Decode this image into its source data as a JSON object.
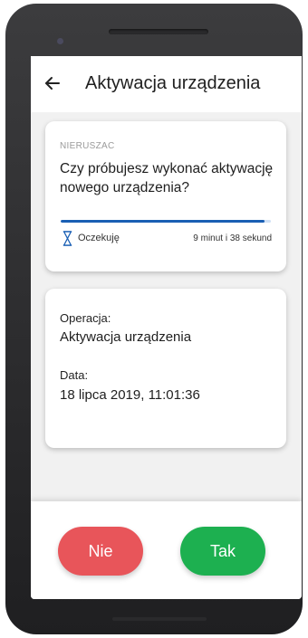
{
  "header": {
    "title": "Aktywacja urządzenia",
    "back_icon": "arrow-left-icon"
  },
  "request_card": {
    "app_label": "NIERUSZAC",
    "question": "Czy próbujesz wykonać aktywację nowego urządzenia?",
    "progress_percent": 97,
    "status_icon": "hourglass-icon",
    "status": "Oczekuję",
    "time_left": "9 minut i 38 sekund"
  },
  "details_card": {
    "operation_label": "Operacja:",
    "operation_value": "Aktywacja urządzenia",
    "date_label": "Data:",
    "date_value": "18 lipca 2019, 11:01:36"
  },
  "actions": {
    "no_label": "Nie",
    "yes_label": "Tak"
  },
  "colors": {
    "accent": "#1a5fb4",
    "no_button": "#e8555a",
    "yes_button": "#1db050"
  }
}
